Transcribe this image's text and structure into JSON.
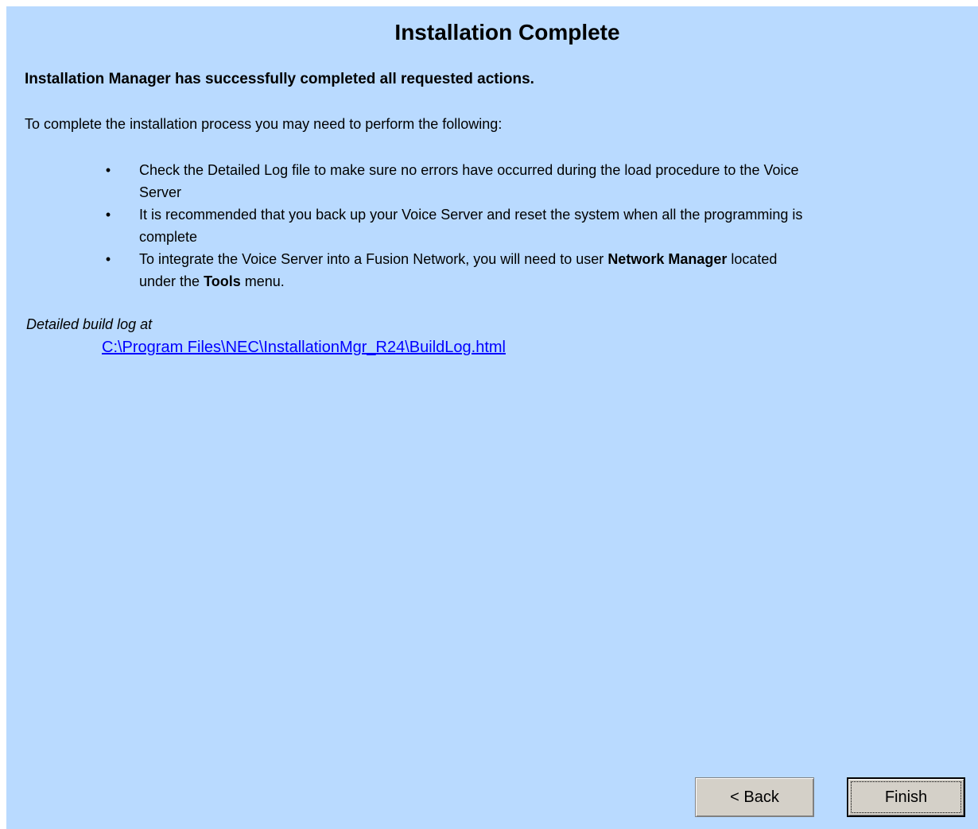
{
  "title": "Installation Complete",
  "headline": "Installation Manager has successfully completed all requested actions.",
  "intro": "To complete the installation process you may need to perform the following:",
  "bullets": {
    "item1": "Check the Detailed Log file to make sure no errors have occurred during the load procedure to the Voice Server",
    "item2": "It is recommended that you back up your Voice Server and reset the system when all the programming is complete",
    "item3": {
      "part1": "To integrate the Voice Server into a Fusion Network, you will need to user ",
      "bold1": "Network Manager",
      "part2": " located under the ",
      "bold2": "Tools",
      "part3": " menu."
    }
  },
  "log": {
    "label": "Detailed build log at",
    "link": "C:\\Program Files\\NEC\\InstallationMgr_R24\\BuildLog.html"
  },
  "buttons": {
    "back": "< Back",
    "finish": "Finish"
  },
  "colors": {
    "panel_background": "#b9daff",
    "link": "#0000ff",
    "button_face": "#d4d0c8"
  }
}
